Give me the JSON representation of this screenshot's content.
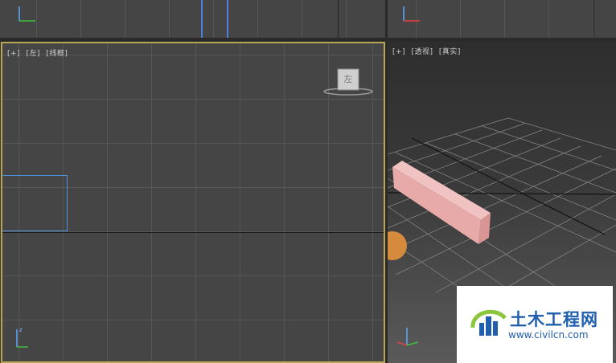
{
  "viewports": {
    "left": {
      "plus": "[+]",
      "view": "[左]",
      "mode": "[线框]"
    },
    "perspective": {
      "plus": "[+]",
      "view": "[透视]",
      "mode": "[真实]"
    }
  },
  "viewcube": {
    "face_label": "左"
  },
  "watermark": {
    "title": "土木工程网",
    "url": "www.civilcn.com"
  },
  "colors": {
    "active_border": "#b8a654",
    "box_color": "#e8a9a9",
    "sphere_color": "#d58a3c"
  }
}
